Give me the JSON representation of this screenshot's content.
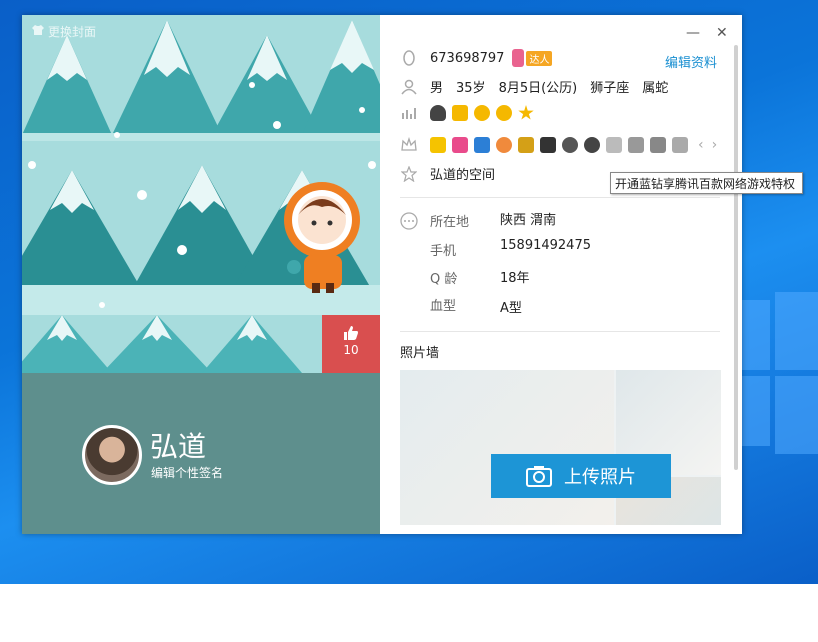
{
  "left_panel": {
    "change_cover_label": "更换封面",
    "like_count": "10",
    "nickname": "弘道",
    "signature_placeholder": "编辑个性签名"
  },
  "header": {
    "qq_number": "673698797",
    "expert_badge": "达人",
    "edit_profile_label": "编辑资料"
  },
  "basic": {
    "gender": "男",
    "age": "35岁",
    "birthday": "8月5日(公历)",
    "zodiac": "狮子座",
    "chinese_zodiac": "属蛇"
  },
  "space_label": "弘道的空间",
  "details": [
    {
      "label": "所在地",
      "value": "陕西 渭南"
    },
    {
      "label": "手机",
      "value": "15891492475"
    },
    {
      "label": "Q 龄",
      "value": "18年"
    },
    {
      "label": "血型",
      "value": "A型"
    }
  ],
  "photo_wall": {
    "title": "照片墙",
    "upload_label": "上传照片"
  },
  "tooltip": "开通蓝钻享腾讯百款网络游戏特权",
  "colors": {
    "accent": "#1d95d6",
    "panel": "#5e8f8d",
    "like": "#d94f4f"
  }
}
